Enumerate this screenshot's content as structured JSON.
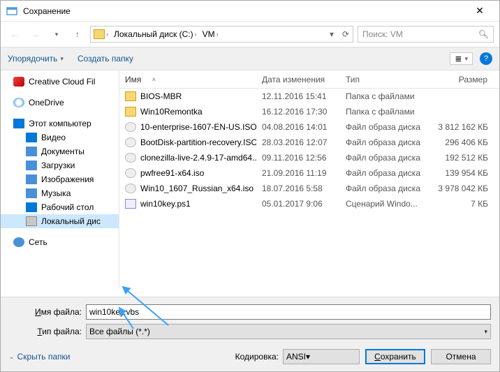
{
  "window": {
    "title": "Сохранение"
  },
  "nav": {
    "breadcrumb": [
      {
        "label": "Локальный диск (C:)"
      },
      {
        "label": "VM"
      }
    ],
    "search_placeholder": "Поиск: VM"
  },
  "toolbar": {
    "organize": "Упорядочить",
    "newfolder": "Создать папку"
  },
  "sidebar": {
    "items": [
      {
        "label": "Creative Cloud Fil",
        "icon": "i-cc"
      },
      {
        "label": "OneDrive",
        "icon": "i-od"
      },
      {
        "label": "Этот компьютер",
        "icon": "i-pc",
        "expanded": true
      },
      {
        "label": "Видео",
        "icon": "i-vid",
        "child": true
      },
      {
        "label": "Документы",
        "icon": "i-doc",
        "child": true
      },
      {
        "label": "Загрузки",
        "icon": "i-dl",
        "child": true
      },
      {
        "label": "Изображения",
        "icon": "i-img",
        "child": true
      },
      {
        "label": "Музыка",
        "icon": "i-mus",
        "child": true
      },
      {
        "label": "Рабочий стол",
        "icon": "i-desk",
        "child": true
      },
      {
        "label": "Локальный дис",
        "icon": "i-drive",
        "child": true,
        "selected": true
      },
      {
        "label": "Сеть",
        "icon": "i-net"
      }
    ]
  },
  "filelist": {
    "headers": {
      "name": "Имя",
      "date": "Дата изменения",
      "type": "Тип",
      "size": "Размер"
    },
    "rows": [
      {
        "name": "BIOS-MBR",
        "date": "12.11.2016 15:41",
        "type": "Папка с файлами",
        "size": "",
        "icon": "i-folder"
      },
      {
        "name": "Win10Remontka",
        "date": "16.12.2016 17:30",
        "type": "Папка с файлами",
        "size": "",
        "icon": "i-folder"
      },
      {
        "name": "10-enterprise-1607-EN-US.ISO",
        "date": "04.08.2016 14:01",
        "type": "Файл образа диска",
        "size": "3 812 162 КБ",
        "icon": "i-iso"
      },
      {
        "name": "BootDisk-partition-recovery.ISO",
        "date": "28.03.2016 12:07",
        "type": "Файл образа диска",
        "size": "296 406 КБ",
        "icon": "i-iso"
      },
      {
        "name": "clonezilla-live-2.4.9-17-amd64...",
        "date": "09.11.2016 12:56",
        "type": "Файл образа диска",
        "size": "192 512 КБ",
        "icon": "i-iso"
      },
      {
        "name": "pwfree91-x64.iso",
        "date": "21.09.2016 11:19",
        "type": "Файл образа диска",
        "size": "139 954 КБ",
        "icon": "i-iso"
      },
      {
        "name": "Win10_1607_Russian_x64.iso",
        "date": "18.07.2016 5:58",
        "type": "Файл образа диска",
        "size": "3 978 042 КБ",
        "icon": "i-iso"
      },
      {
        "name": "win10key.ps1",
        "date": "05.01.2017 9:06",
        "type": "Сценарий Windo...",
        "size": "7 КБ",
        "icon": "i-ps1"
      }
    ]
  },
  "form": {
    "filename_label": "Имя файла:",
    "filename_value": "win10key.vbs",
    "filetype_label": "Тип файла:",
    "filetype_value": "Все файлы  (*.*)",
    "hide_folders": "Скрыть папки",
    "encoding_label": "Кодировка:",
    "encoding_value": "ANSI",
    "save": "Сохранить",
    "cancel": "Отмена"
  }
}
